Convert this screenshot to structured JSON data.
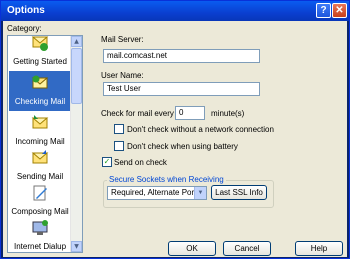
{
  "window": {
    "title": "Options"
  },
  "category": {
    "label": "Category:",
    "items": [
      {
        "label": "Getting Started",
        "icon": "getting-started-icon",
        "selected": false
      },
      {
        "label": "Checking Mail",
        "icon": "checking-mail-icon",
        "selected": true
      },
      {
        "label": "Incoming Mail",
        "icon": "incoming-mail-icon",
        "selected": false
      },
      {
        "label": "Sending Mail",
        "icon": "sending-mail-icon",
        "selected": false
      },
      {
        "label": "Composing Mail",
        "icon": "composing-mail-icon",
        "selected": false
      },
      {
        "label": "Internet Dialup",
        "icon": "internet-dialup-icon",
        "selected": false
      }
    ]
  },
  "form": {
    "mail_server_label": "Mail Server:",
    "mail_server_value": "mail.comcast.net",
    "user_name_label": "User Name:",
    "user_name_value": "Test User",
    "check_every_label": "Check for mail every",
    "check_every_value": "0",
    "minutes_label": "minute(s)",
    "no_network_label": "Don't check without a network connection",
    "no_network_checked": false,
    "battery_label": "Don't check when using battery",
    "battery_checked": false,
    "send_on_check_label": "Send on check",
    "send_on_check_checked": true,
    "ssl_group_label": "Secure Sockets when Receiving",
    "ssl_select_value": "Required, Alternate Port",
    "last_ssl_label": "Last SSL Info"
  },
  "buttons": {
    "ok": "OK",
    "cancel": "Cancel",
    "help": "Help"
  },
  "colors": {
    "title_bar": "#0a3fd0",
    "selection": "#316ac5",
    "dialog_bg": "#ece9d8",
    "group_title": "#0046d5"
  }
}
